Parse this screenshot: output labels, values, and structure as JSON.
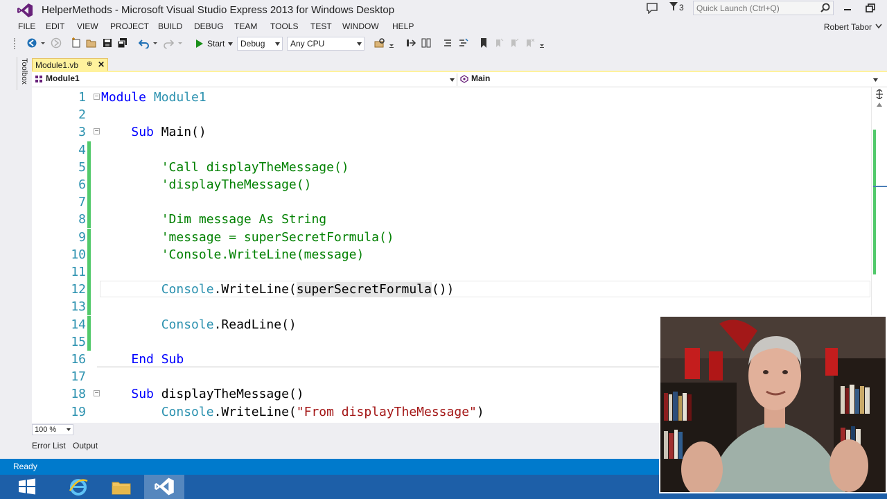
{
  "window": {
    "title": "HelperMethods - Microsoft Visual Studio Express 2013 for Windows Desktop",
    "filter_count": "3",
    "quick_launch_placeholder": "Quick Launch (Ctrl+Q)",
    "user_name": "Robert Tabor"
  },
  "menu": [
    "FILE",
    "EDIT",
    "VIEW",
    "PROJECT",
    "BUILD",
    "DEBUG",
    "TEAM",
    "TOOLS",
    "TEST",
    "WINDOW",
    "HELP"
  ],
  "toolbar": {
    "start_label": "Start",
    "configuration": "Debug",
    "platform": "Any CPU"
  },
  "toolbox_label": "Toolbox",
  "document": {
    "tab_label": "Module1.vb",
    "nav_left": "Module1",
    "nav_right": "Main"
  },
  "code_lines": [
    {
      "n": "1",
      "parts": [
        {
          "t": "Module",
          "c": "kw"
        },
        {
          "t": " "
        },
        {
          "t": "Module1",
          "c": "typ"
        }
      ]
    },
    {
      "n": "2",
      "parts": []
    },
    {
      "n": "3",
      "parts": [
        {
          "t": "    "
        },
        {
          "t": "Sub",
          "c": "kw"
        },
        {
          "t": " Main()"
        }
      ]
    },
    {
      "n": "4",
      "parts": []
    },
    {
      "n": "5",
      "parts": [
        {
          "t": "        "
        },
        {
          "t": "'Call displayTheMessage()",
          "c": "cmt"
        }
      ]
    },
    {
      "n": "6",
      "parts": [
        {
          "t": "        "
        },
        {
          "t": "'displayTheMessage()",
          "c": "cmt"
        }
      ]
    },
    {
      "n": "7",
      "parts": []
    },
    {
      "n": "8",
      "parts": [
        {
          "t": "        "
        },
        {
          "t": "'Dim message As String",
          "c": "cmt"
        }
      ]
    },
    {
      "n": "9",
      "parts": [
        {
          "t": "        "
        },
        {
          "t": "'message = superSecretFormula()",
          "c": "cmt"
        }
      ]
    },
    {
      "n": "10",
      "parts": [
        {
          "t": "        "
        },
        {
          "t": "'Console.WriteLine(message)",
          "c": "cmt"
        }
      ]
    },
    {
      "n": "11",
      "parts": []
    },
    {
      "n": "12",
      "parts": [
        {
          "t": "        "
        },
        {
          "t": "Console",
          "c": "typ"
        },
        {
          "t": ".WriteLine("
        },
        {
          "t": "superSecret",
          "c": "hl-word"
        },
        {
          "t": "",
          "c": "caret"
        },
        {
          "t": "Formula",
          "c": "hl-word"
        },
        {
          "t": "())"
        }
      ]
    },
    {
      "n": "13",
      "parts": []
    },
    {
      "n": "14",
      "parts": [
        {
          "t": "        "
        },
        {
          "t": "Console",
          "c": "typ"
        },
        {
          "t": ".ReadLine()"
        }
      ]
    },
    {
      "n": "15",
      "parts": []
    },
    {
      "n": "16",
      "parts": [
        {
          "t": "    "
        },
        {
          "t": "End",
          "c": "kw"
        },
        {
          "t": " "
        },
        {
          "t": "Sub",
          "c": "kw"
        }
      ]
    },
    {
      "n": "17",
      "parts": []
    },
    {
      "n": "18",
      "parts": [
        {
          "t": "    "
        },
        {
          "t": "Sub",
          "c": "kw"
        },
        {
          "t": " displayTheMessage()"
        }
      ]
    },
    {
      "n": "19",
      "parts": [
        {
          "t": "        "
        },
        {
          "t": "Console",
          "c": "typ"
        },
        {
          "t": ".WriteLine("
        },
        {
          "t": "\"From displayTheMessage\"",
          "c": "str"
        },
        {
          "t": ")"
        }
      ]
    }
  ],
  "zoom": "100 %",
  "tool_windows": [
    "Error List",
    "Output"
  ],
  "status": "Ready"
}
